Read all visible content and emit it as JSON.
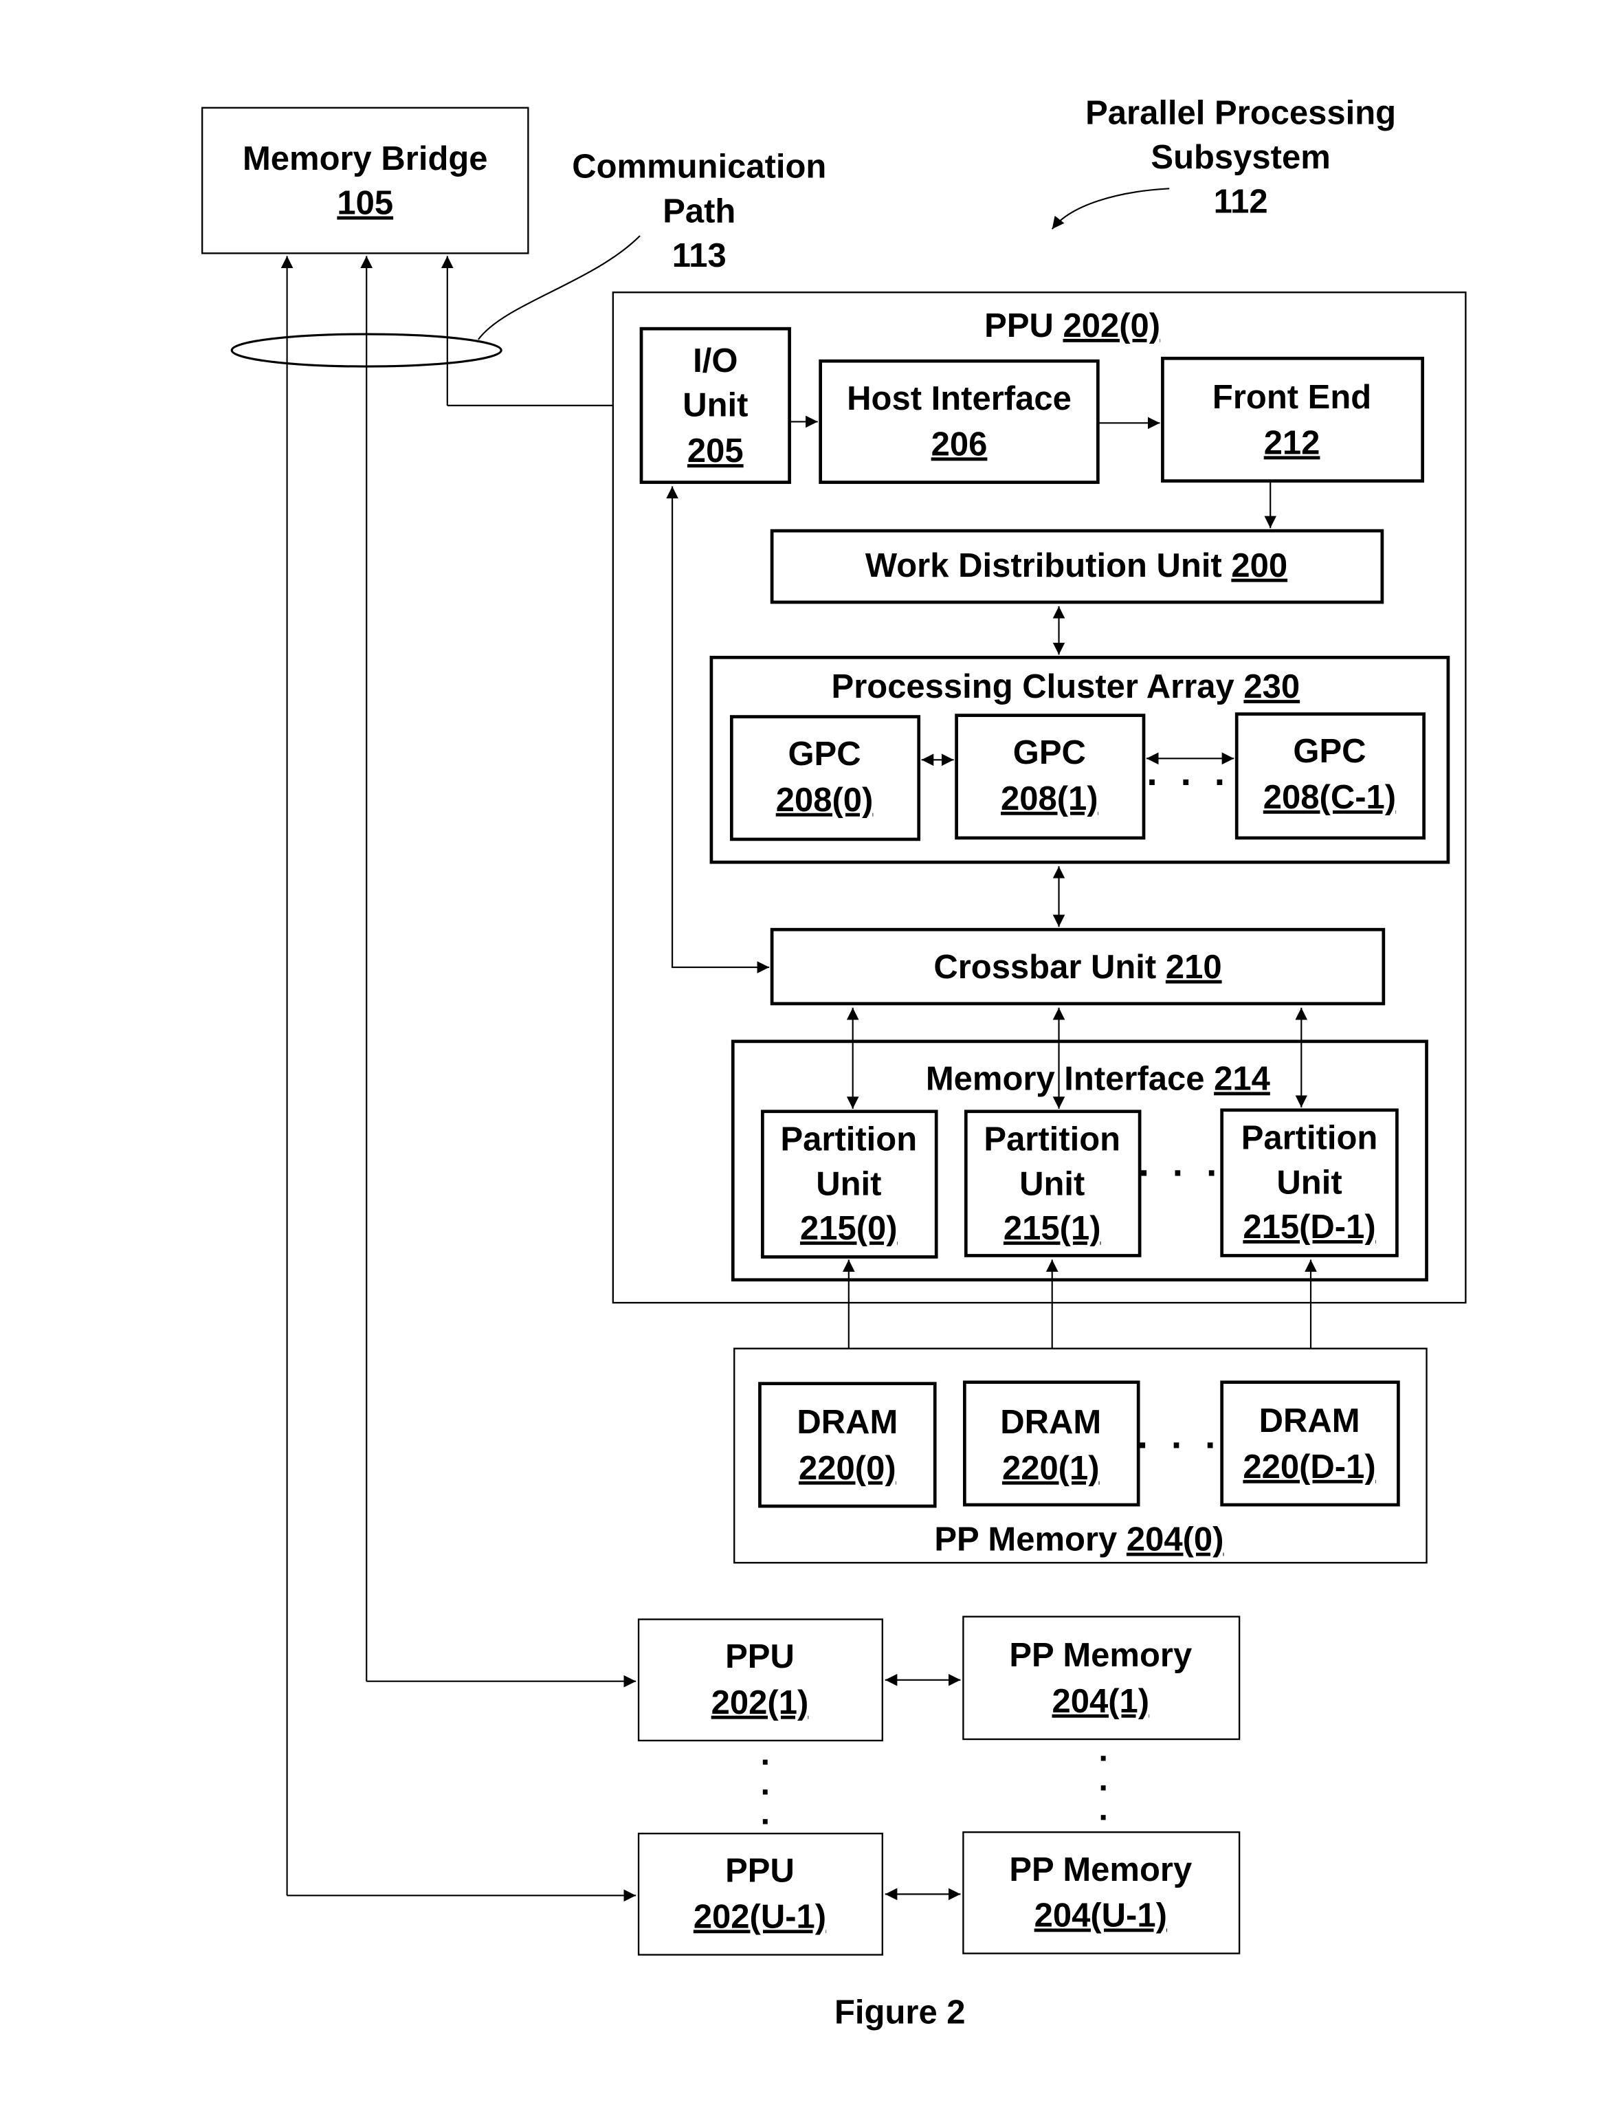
{
  "figure_label": "Figure 2",
  "memory_bridge": {
    "line1": "Memory Bridge",
    "ref": "105"
  },
  "communication_path": {
    "line1": "Communication",
    "line2": "Path",
    "ref": "113"
  },
  "subsystem": {
    "line1": "Parallel Processing",
    "line2": "Subsystem",
    "ref": "112"
  },
  "ppu0": {
    "label": "PPU ",
    "ref": "202(0)",
    "io_unit": {
      "line1": "I/O",
      "line2": "Unit",
      "ref": "205"
    },
    "host_interface": {
      "line1": "Host Interface",
      "ref": "206"
    },
    "front_end": {
      "line1": "Front End",
      "ref": "212"
    },
    "work_distribution": {
      "label": "Work Distribution Unit ",
      "ref": "200"
    },
    "processing_cluster_array": {
      "label": "Processing Cluster Array ",
      "ref": "230",
      "gpcs": [
        {
          "name": "GPC",
          "ref": "208(0)"
        },
        {
          "name": "GPC",
          "ref": "208(1)"
        },
        {
          "name": "GPC",
          "ref": "208(C-1)"
        }
      ],
      "ellipsis": "· · ·"
    },
    "crossbar": {
      "label": "Crossbar Unit ",
      "ref": "210"
    },
    "memory_interface": {
      "label": "Memory Interface ",
      "ref": "214",
      "partitions": [
        {
          "line1": "Partition",
          "line2": "Unit",
          "ref": "215(0)"
        },
        {
          "line1": "Partition",
          "line2": "Unit",
          "ref": "215(1)"
        },
        {
          "line1": "Partition",
          "line2": "Unit",
          "ref": "215(D-1)"
        }
      ],
      "ellipsis": "· · ·"
    }
  },
  "pp_memory0": {
    "label": "PP Memory ",
    "ref": "204(0)",
    "drams": [
      {
        "name": "DRAM",
        "ref": "220(0)"
      },
      {
        "name": "DRAM",
        "ref": "220(1)"
      },
      {
        "name": "DRAM",
        "ref": "220(D-1)"
      }
    ],
    "ellipsis": "· · ·"
  },
  "ppu1": {
    "name": "PPU",
    "ref": "202(1)"
  },
  "pp_memory1": {
    "name": "PP Memory",
    "ref": "204(1)"
  },
  "ppu_last": {
    "name": "PPU",
    "ref": "202(U-1)"
  },
  "pp_memory_last": {
    "name": "PP Memory",
    "ref": "204(U-1)"
  },
  "vertical_ellipsis": "."
}
